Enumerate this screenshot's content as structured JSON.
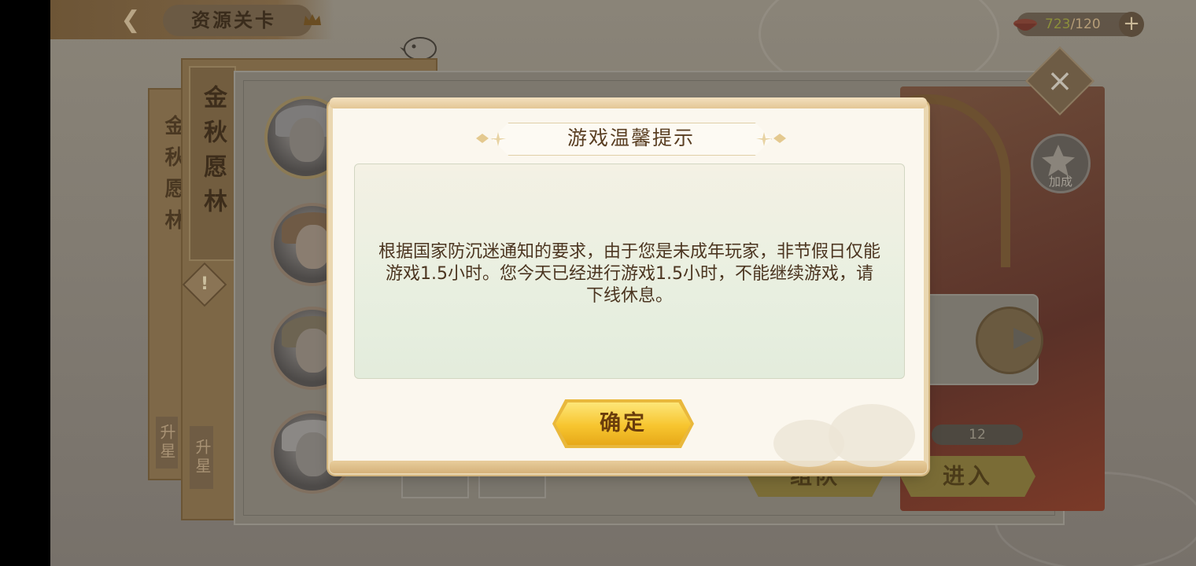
{
  "header": {
    "title": "资源关卡",
    "stamina_current": "723",
    "stamina_max": "/120"
  },
  "stages": {
    "banner_main": "金秋愿林",
    "banner_back": "金秋愿林",
    "upgrade_main": "升星",
    "upgrade_back": "升星",
    "warning_mark": "!"
  },
  "side": {
    "buff_label": "加成",
    "count": "12",
    "team_button": "组队",
    "enter_button": "进入"
  },
  "dialog": {
    "title": "游戏温馨提示",
    "message": "根据国家防沉迷通知的要求，由于您是未成年玩家，非节假日仅能游戏1.5小时。您今天已经进行游戏1.5小时，不能继续游戏，请下线休息。",
    "confirm": "确定"
  },
  "icons": [
    "back-icon",
    "crown-icon",
    "stamina-bowl-icon",
    "plus-icon",
    "bird-icon",
    "close-icon",
    "warning-icon",
    "buff-icon",
    "arrow-right-icon"
  ],
  "colors": {
    "dialog_bg": "#fbf7ee",
    "dialog_text": "#4b3520",
    "confirm_gold": "#f7c52f",
    "frame_gold": "#d2b47d"
  }
}
